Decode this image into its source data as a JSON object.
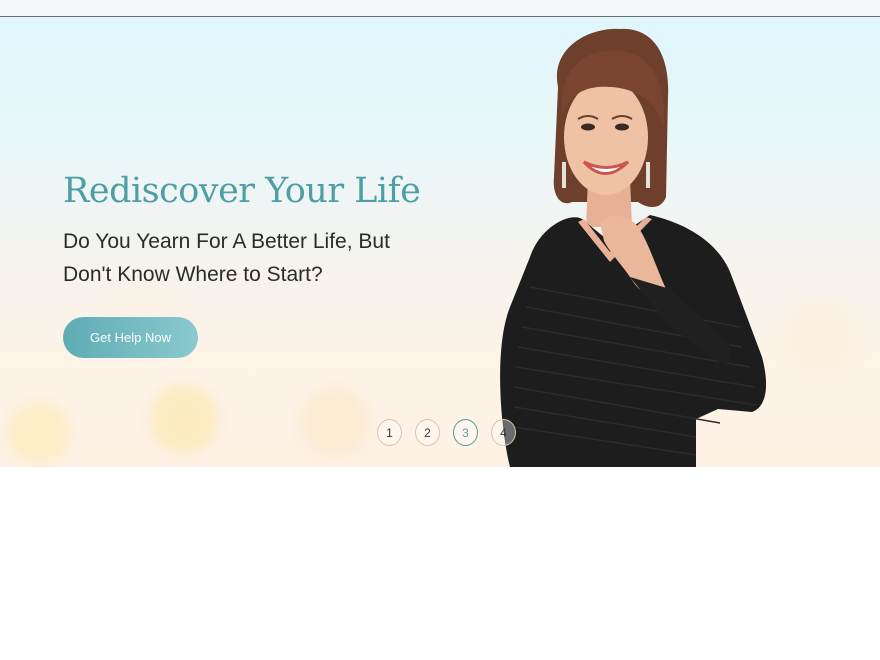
{
  "hero": {
    "headline": "Rediscover Your Life",
    "subhead_line1": "Do You Yearn For A Better Life, But",
    "subhead_line2": "Don't Know Where to Start?",
    "cta_label": "Get Help Now",
    "image_label": "portrait of smiling woman in black top"
  },
  "slider": {
    "dots": [
      "1",
      "2",
      "3",
      "4"
    ],
    "active_index": 3
  },
  "colors": {
    "accent": "#4f9ea6",
    "button_start": "#5eacb4",
    "button_end": "#8ac9cf",
    "text_dark": "#2b2b2b"
  }
}
